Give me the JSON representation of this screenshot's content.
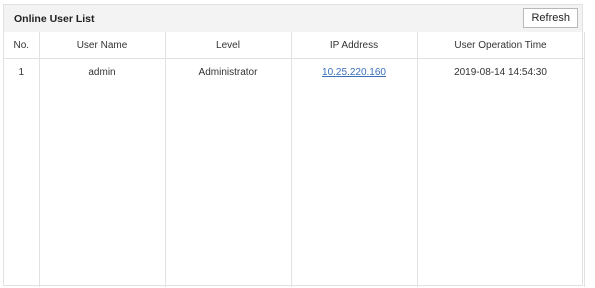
{
  "header": {
    "title": "Online User List",
    "refresh_label": "Refresh"
  },
  "table": {
    "columns": [
      "No.",
      "User Name",
      "Level",
      "IP Address",
      "User Operation Time"
    ],
    "rows": [
      {
        "no": "1",
        "user": "admin",
        "level": "Administrator",
        "ip": "10.25.220.160",
        "time": "2019-08-14 14:54:30"
      }
    ]
  },
  "colors": {
    "link": "#3a6fb8",
    "header_bg": "#f3f3f3",
    "border": "#e2e2e2"
  }
}
